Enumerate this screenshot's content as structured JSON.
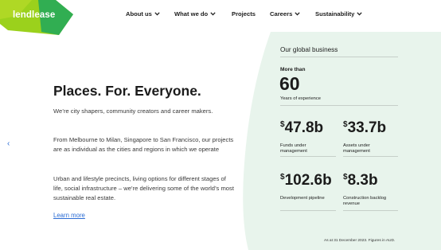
{
  "brand": {
    "logo_text": "lendlease",
    "logo_green": "#9bd11c",
    "logo_teal": "#1fa85c"
  },
  "nav": [
    {
      "label": "About us",
      "has_dropdown": true
    },
    {
      "label": "What we do",
      "has_dropdown": true
    },
    {
      "label": "Projects",
      "has_dropdown": false
    },
    {
      "label": "Careers",
      "has_dropdown": true
    },
    {
      "label": "Sustainability",
      "has_dropdown": true
    }
  ],
  "hero": {
    "title": "Places. For. Everyone.",
    "paragraphs": [
      "We’re city shapers, community creators and career makers.",
      "From Melbourne to Milan, Singapore to San Francisco, our projects are as individual as the cities and regions in which we operate",
      "Urban and lifestyle precincts, living options for different stages of life, social infrastructure – we’re delivering some of the world’s most sustainable real estate."
    ],
    "link": "Learn more"
  },
  "carousel": {
    "prev_icon": "chevron-left-icon",
    "prev_glyph": "‹"
  },
  "global_business": {
    "title": "Our global business",
    "years": {
      "prefix": "More than",
      "value": "60",
      "label": "Years of experience"
    },
    "stats": [
      {
        "currency": "$",
        "value": "47.8b",
        "label": "Funds under management"
      },
      {
        "currency": "$",
        "value": "33.7b",
        "label": "Assets under management"
      },
      {
        "currency": "$",
        "value": "102.6b",
        "label": "Development pipeline"
      },
      {
        "currency": "$",
        "value": "8.3b",
        "label": "Construction backlog revenue"
      }
    ],
    "footnote": "As at 31 December 2023. Figures in AUD.",
    "bg_color": "#e8f4ec"
  },
  "colors": {
    "link": "#2b6cd4",
    "text": "#1b1b1b"
  }
}
